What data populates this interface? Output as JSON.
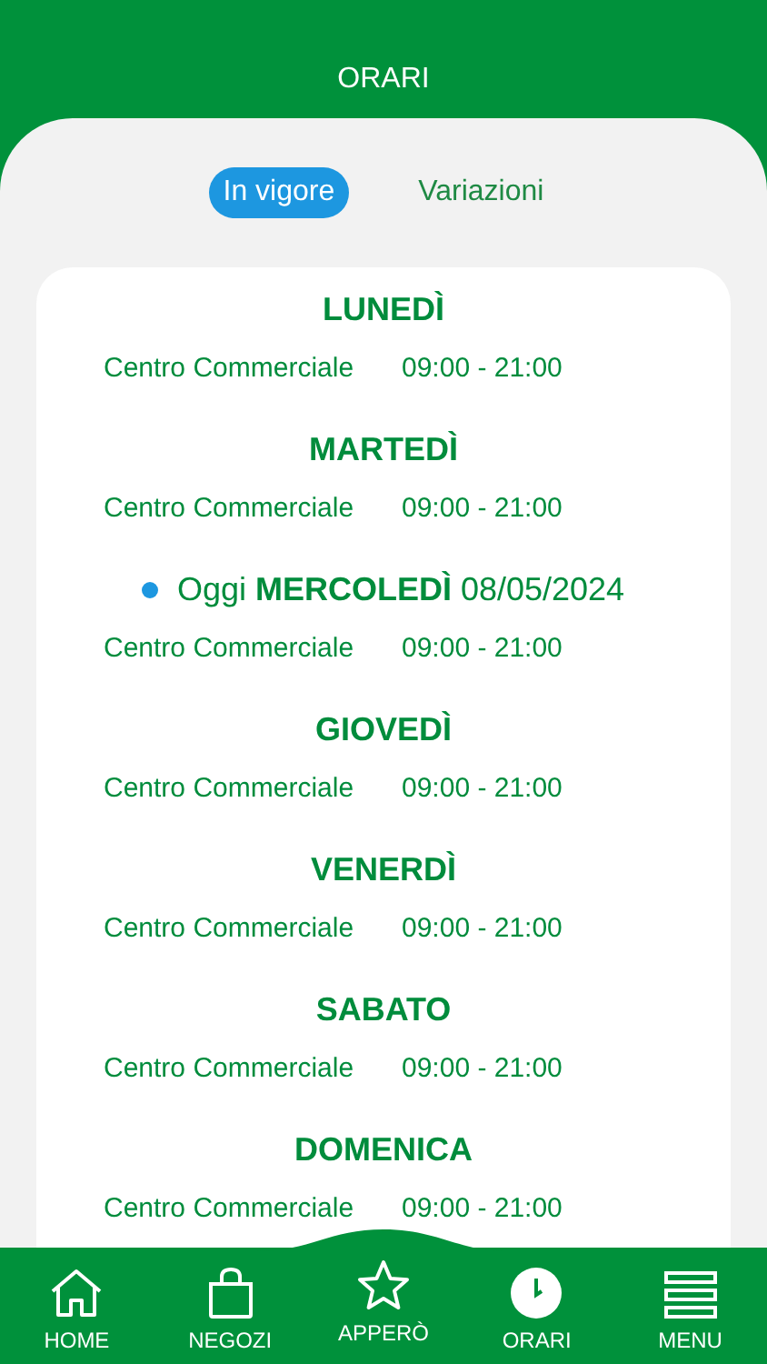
{
  "header": {
    "title": "ORARI"
  },
  "tabs": [
    {
      "label": "In vigore",
      "selected": true
    },
    {
      "label": "Variazioni",
      "selected": false
    }
  ],
  "days": [
    {
      "kind": "day",
      "title": "LUNEDÌ",
      "rows": [
        {
          "place": "Centro Commerciale",
          "hours": "09:00 - 21:00"
        }
      ]
    },
    {
      "kind": "day",
      "title": "MARTEDÌ",
      "rows": [
        {
          "place": "Centro Commerciale",
          "hours": "09:00 - 21:00"
        }
      ]
    },
    {
      "kind": "today",
      "title": "Oggi **MERCOLEDÌ** 08/05/2024",
      "rows": [
        {
          "place": "Centro Commerciale",
          "hours": "09:00 - 21:00"
        }
      ]
    },
    {
      "kind": "day",
      "title": "GIOVEDÌ",
      "rows": [
        {
          "place": "Centro Commerciale",
          "hours": "09:00 - 21:00"
        }
      ]
    },
    {
      "kind": "day",
      "title": "VENERDÌ",
      "rows": [
        {
          "place": "Centro Commerciale",
          "hours": "09:00 - 21:00"
        }
      ]
    },
    {
      "kind": "day",
      "title": "SABATO",
      "rows": [
        {
          "place": "Centro Commerciale",
          "hours": "09:00 - 21:00"
        }
      ]
    },
    {
      "kind": "day",
      "title": "DOMENICA",
      "rows": [
        {
          "place": "Centro Commerciale",
          "hours": "09:00 - 21:00"
        }
      ]
    }
  ],
  "nav": [
    {
      "kind": "home",
      "label": "HOME"
    },
    {
      "kind": "bag",
      "label": "NEGOZI"
    },
    {
      "kind": "star",
      "label": "APPERÒ"
    },
    {
      "kind": "clock",
      "label": "ORARI"
    },
    {
      "kind": "menu",
      "label": "MENU"
    }
  ]
}
